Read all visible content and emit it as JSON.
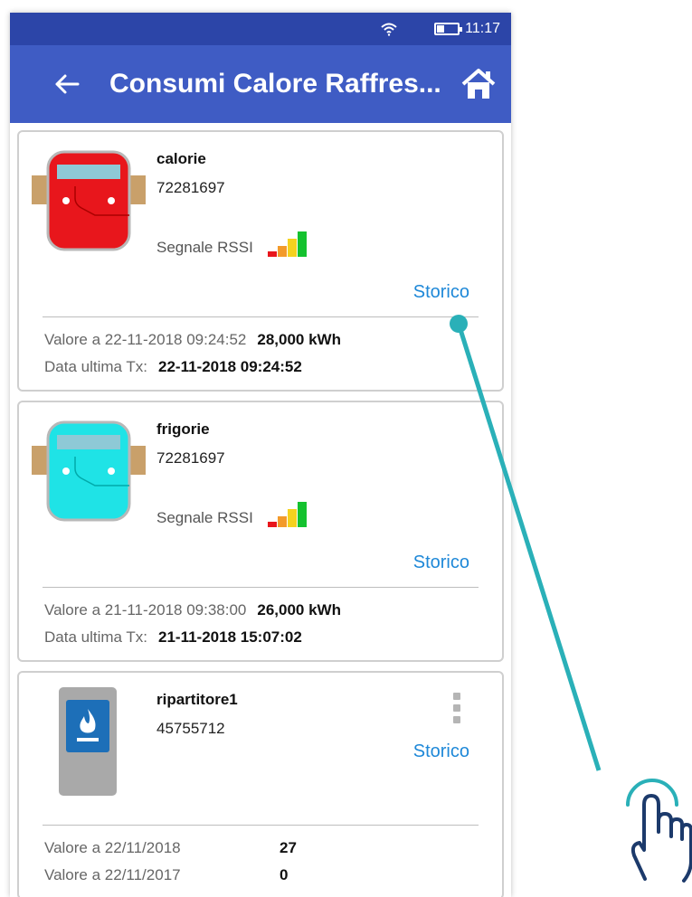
{
  "status_bar": {
    "time": "11:17",
    "wifi_icon": "wifi-icon",
    "battery_icon": "battery-icon"
  },
  "app_bar": {
    "title": "Consumi Calore Raffres...",
    "back_icon": "back-arrow-icon",
    "home_icon": "home-icon"
  },
  "colors": {
    "status_bar": "#2c45a8",
    "app_bar": "#3f5cc4",
    "link": "#1e88d8",
    "accent": "#2ab0b8"
  },
  "cards": [
    {
      "name": "calorie",
      "serial": "72281697",
      "rssi_label": "Segnale RSSI",
      "history_link": "Storico",
      "value_label": "Valore a 22-11-2018 09:24:52",
      "value": "28,000 kWh",
      "tx_label": "Data ultima Tx:",
      "tx_value": "22-11-2018 09:24:52",
      "meter_color": "#e8161c"
    },
    {
      "name": "frigorie",
      "serial": "72281697",
      "rssi_label": "Segnale RSSI",
      "history_link": "Storico",
      "value_label": "Valore a 21-11-2018 09:38:00",
      "value": "26,000 kWh",
      "tx_label": "Data ultima Tx:",
      "tx_value": "21-11-2018 15:07:02",
      "meter_color": "#1fe3e6"
    },
    {
      "name": "ripartitore1",
      "serial": "45755712",
      "history_link": "Storico",
      "rows": [
        {
          "label": "Valore a 22/11/2018",
          "value": "27"
        },
        {
          "label": "Valore a 22/11/2017",
          "value": "0"
        }
      ]
    }
  ]
}
